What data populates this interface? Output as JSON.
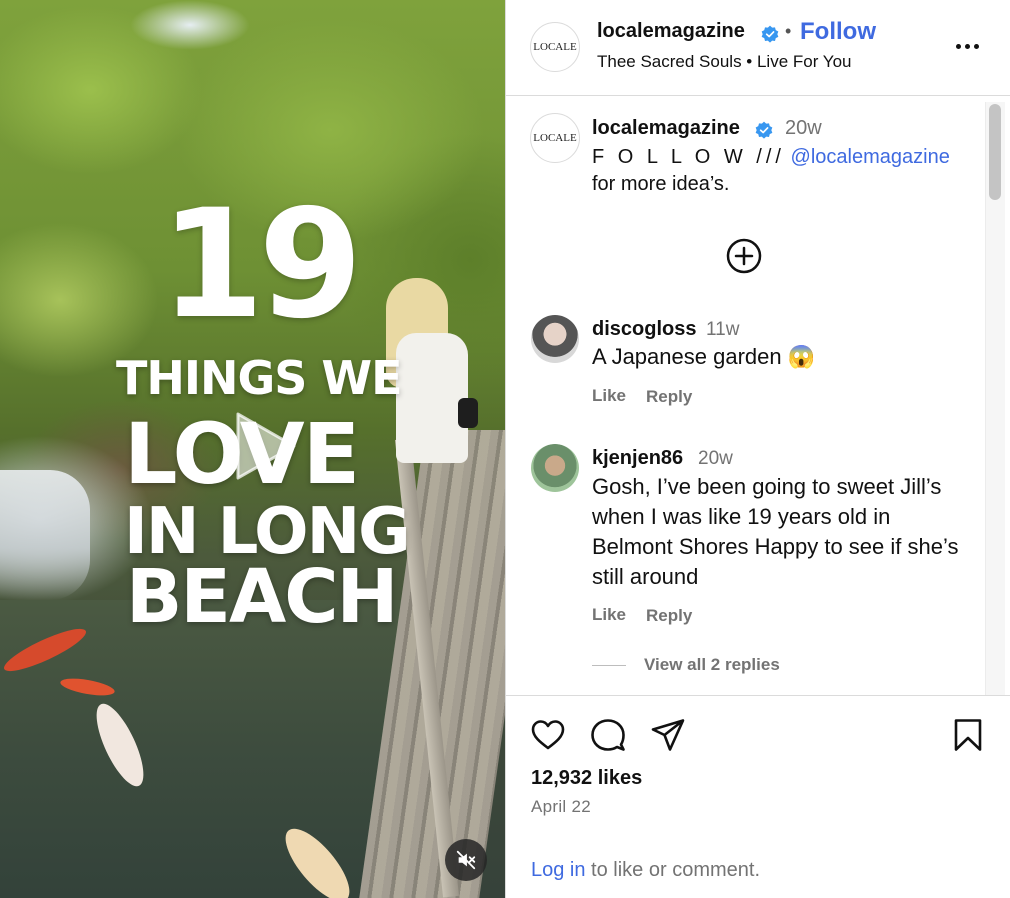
{
  "post": {
    "account": "localemagazine",
    "avatar_text": "LOCALE",
    "follow_label": "Follow",
    "separator": "•",
    "audio": "Thee Sacred Souls • Live For You"
  },
  "media": {
    "overlay_number": "19",
    "overlay_line1": "THINGS WE",
    "overlay_line2": "LOVE",
    "overlay_line3": "IN LONG",
    "overlay_line4": "BEACH"
  },
  "caption": {
    "account": "localemagazine",
    "age": "20w",
    "lead": "F O L L O W ///",
    "mention": "@localemagazine",
    "rest": " for more idea’s."
  },
  "comments": [
    {
      "user": "discogloss",
      "age": "11w",
      "text": "A Japanese garden 😱",
      "like": "Like",
      "reply": "Reply"
    },
    {
      "user": "kjenjen86",
      "age": "20w",
      "text": "Gosh, I’ve been going to sweet Jill’s when I was like 19 years old in Belmont Shores Happy to see if she’s still around",
      "like": "Like",
      "reply": "Reply",
      "view_replies": "View all 2 replies"
    }
  ],
  "stats": {
    "likes": "12,932 likes",
    "date": "April 22"
  },
  "login_prompt": {
    "link": "Log in",
    "text": " to like or comment."
  },
  "colors": {
    "accent": "#3f6ae0",
    "verified": "#3897f0",
    "muted": "#737373"
  },
  "icons": [
    "play-icon",
    "mute-icon",
    "verified-icon",
    "more-icon",
    "add-circle-icon",
    "heart-icon",
    "comment-icon",
    "share-icon",
    "bookmark-icon"
  ]
}
